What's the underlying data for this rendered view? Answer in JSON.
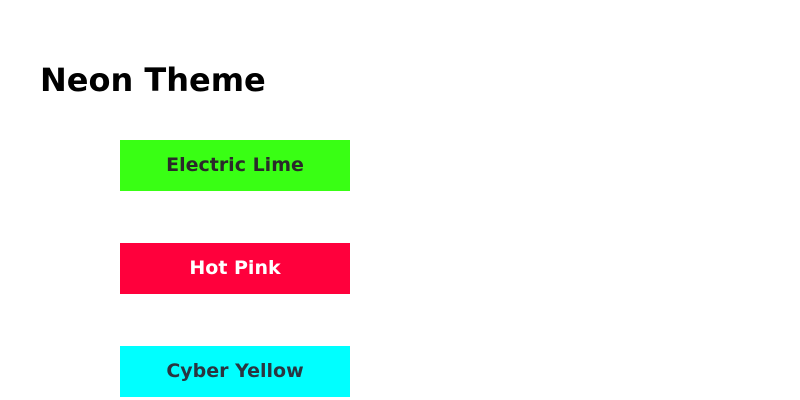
{
  "header": {
    "title": "Neon Theme"
  },
  "buttons": [
    {
      "label": "Electric Lime",
      "background": "#39ff14",
      "text_color": "#2a2a2a"
    },
    {
      "label": "Hot Pink",
      "background": "#ff003c",
      "text_color": "#ffffff"
    },
    {
      "label": "Cyber Yellow",
      "background": "#00ffff",
      "text_color": "#2a3540"
    }
  ]
}
